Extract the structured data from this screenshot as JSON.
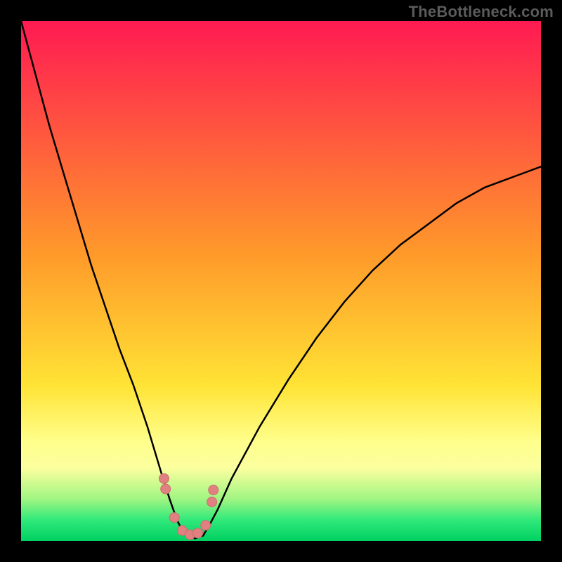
{
  "watermark": "TheBottleneck.com",
  "colors": {
    "bg_black": "#000000",
    "grad_top": "#ff1a52",
    "grad_mid": "#ffe335",
    "grad_low_yellow": "#ffff8c",
    "grad_green": "#2fe97a",
    "grad_bottom_green": "#00d062",
    "curve": "#000000",
    "bead_fill": "#e08080",
    "bead_stroke": "#c86e6e"
  },
  "chart_data": {
    "type": "line",
    "title": "",
    "xlabel": "",
    "ylabel": "",
    "xlim": [
      0,
      100
    ],
    "ylim": [
      0,
      100
    ],
    "grid": false,
    "legend": false,
    "series": [
      {
        "name": "bottleneck-curve",
        "x": [
          0,
          2.7,
          5.4,
          8.1,
          10.8,
          13.5,
          16.2,
          18.9,
          21.6,
          24.3,
          27.0,
          28.6,
          30.0,
          31.0,
          32.0,
          33.5,
          35.0,
          36.2,
          37.8,
          40.5,
          45.9,
          51.4,
          56.8,
          62.2,
          67.6,
          73.0,
          78.4,
          83.8,
          89.2,
          94.6,
          100.0
        ],
        "y": [
          100,
          90,
          80,
          71,
          62,
          53,
          45,
          37,
          30,
          22,
          13,
          8,
          4,
          2,
          1,
          0.5,
          1,
          3,
          6,
          12,
          22,
          31,
          39,
          46,
          52,
          57,
          61,
          65,
          68,
          70,
          72
        ]
      }
    ],
    "annotations": {
      "beads_x": [
        27.5,
        27.8,
        29.5,
        31.0,
        32.5,
        34.0,
        35.5,
        36.7,
        37.0
      ],
      "beads_y": [
        12,
        10,
        4.5,
        2,
        1.2,
        1.5,
        3,
        7.5,
        9.8
      ]
    },
    "gradient_stops": [
      {
        "pct": 0,
        "color": "#ff1a52"
      },
      {
        "pct": 45,
        "color": "#ff9a2a"
      },
      {
        "pct": 70,
        "color": "#ffe335"
      },
      {
        "pct": 81,
        "color": "#ffff8c"
      },
      {
        "pct": 86,
        "color": "#fbff9e"
      },
      {
        "pct": 92,
        "color": "#9ff582"
      },
      {
        "pct": 96,
        "color": "#2fe97a"
      },
      {
        "pct": 100,
        "color": "#00d062"
      }
    ]
  }
}
